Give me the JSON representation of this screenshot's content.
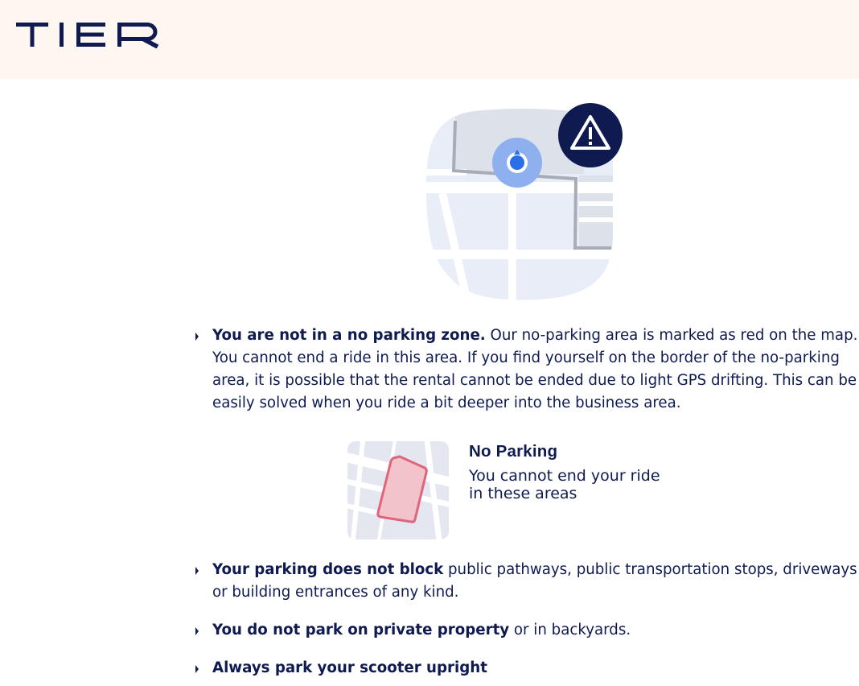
{
  "header": {
    "brand": "TIER",
    "logo_icon": "tier-wordmark"
  },
  "hero": {
    "map_icon": "map-location-icon",
    "warning_icon": "warning-triangle-icon"
  },
  "bullets": [
    {
      "bold": "You are not in a no parking zone.",
      "text": " Our no-parking area is marked as red on the map. You cannot end a ride in this area. If you find yourself on the border of the no-parking area, it is possible that the rental cannot be ended due to light GPS drifting. This can be easily solved when you ride a bit deeper into the business area."
    },
    {
      "bold": "Your parking does not block",
      "text": " public pathways, public transportation stops, driveways or building entrances of any kind."
    },
    {
      "bold": "You do not park on private property",
      "text": " or in backyards."
    },
    {
      "bold": "Always park your scooter upright",
      "text": ""
    }
  ],
  "no_parking": {
    "title": "No Parking",
    "subtitle_line1": "You cannot end your ride",
    "subtitle_line2": "in these areas",
    "zone_color": "#e0647a"
  },
  "colors": {
    "navy": "#0e1a50",
    "header_bg": "#fdf6f1",
    "accent_blue": "#2a6ee8"
  }
}
